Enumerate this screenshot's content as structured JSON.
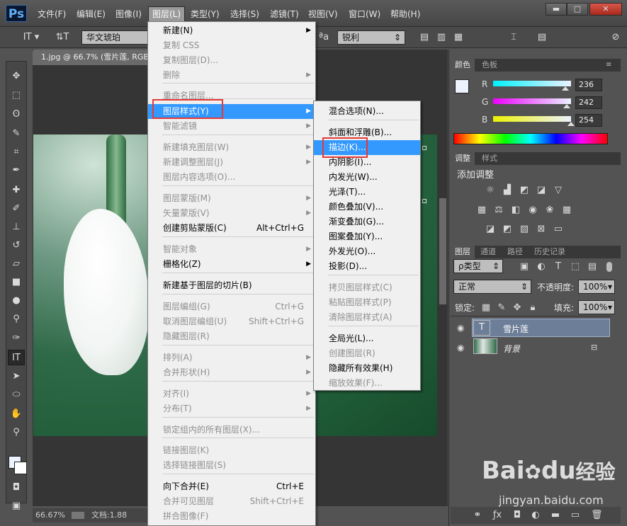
{
  "app": {
    "logo": "Ps"
  },
  "menubar": {
    "items": [
      "文件(F)",
      "编辑(E)",
      "图像(I)",
      "图层(L)",
      "类型(Y)",
      "选择(S)",
      "滤镜(T)",
      "视图(V)",
      "窗口(W)",
      "帮助(H)"
    ]
  },
  "window_buttons": {
    "minimize": "▬",
    "maximize": "□",
    "close": "✕"
  },
  "options": {
    "font_family": "华文琥珀",
    "antialias": "锐利",
    "aa_label": "ªa"
  },
  "document": {
    "tab_title": "1.jpg @ 66.7% (雪片莲, RGB",
    "zoom": "66.67%",
    "doc_info": "文档:1.88"
  },
  "layer_menu": {
    "items": [
      {
        "label": "新建(N)",
        "shortcut": "",
        "arrow": true,
        "disabled": false
      },
      {
        "label": "复制 CSS",
        "shortcut": "",
        "arrow": false,
        "disabled": true
      },
      {
        "label": "复制图层(D)...",
        "shortcut": "",
        "arrow": false,
        "disabled": true
      },
      {
        "label": "删除",
        "shortcut": "",
        "arrow": true,
        "disabled": true
      },
      {
        "label": "重命名图层...",
        "shortcut": "",
        "arrow": false,
        "disabled": true
      },
      {
        "label": "图层样式(Y)",
        "shortcut": "",
        "arrow": true,
        "disabled": false,
        "highlighted": true
      },
      {
        "label": "智能滤镜",
        "shortcut": "",
        "arrow": true,
        "disabled": true
      },
      {
        "label": "新建填充图层(W)",
        "shortcut": "",
        "arrow": true,
        "disabled": true
      },
      {
        "label": "新建调整图层(J)",
        "shortcut": "",
        "arrow": true,
        "disabled": true
      },
      {
        "label": "图层内容选项(O)...",
        "shortcut": "",
        "arrow": false,
        "disabled": true
      },
      {
        "label": "图层蒙版(M)",
        "shortcut": "",
        "arrow": true,
        "disabled": true
      },
      {
        "label": "矢量蒙版(V)",
        "shortcut": "",
        "arrow": true,
        "disabled": true
      },
      {
        "label": "创建剪贴蒙版(C)",
        "shortcut": "Alt+Ctrl+G",
        "arrow": false,
        "disabled": false
      },
      {
        "label": "智能对象",
        "shortcut": "",
        "arrow": true,
        "disabled": true
      },
      {
        "label": "栅格化(Z)",
        "shortcut": "",
        "arrow": true,
        "disabled": false
      },
      {
        "label": "新建基于图层的切片(B)",
        "shortcut": "",
        "arrow": false,
        "disabled": false
      },
      {
        "label": "图层编组(G)",
        "shortcut": "Ctrl+G",
        "arrow": false,
        "disabled": true
      },
      {
        "label": "取消图层编组(U)",
        "shortcut": "Shift+Ctrl+G",
        "arrow": false,
        "disabled": true
      },
      {
        "label": "隐藏图层(R)",
        "shortcut": "",
        "arrow": false,
        "disabled": true
      },
      {
        "label": "排列(A)",
        "shortcut": "",
        "arrow": true,
        "disabled": true
      },
      {
        "label": "合并形状(H)",
        "shortcut": "",
        "arrow": true,
        "disabled": true
      },
      {
        "label": "对齐(I)",
        "shortcut": "",
        "arrow": true,
        "disabled": true
      },
      {
        "label": "分布(T)",
        "shortcut": "",
        "arrow": true,
        "disabled": true
      },
      {
        "label": "锁定组内的所有图层(X)...",
        "shortcut": "",
        "arrow": false,
        "disabled": true
      },
      {
        "label": "链接图层(K)",
        "shortcut": "",
        "arrow": false,
        "disabled": true
      },
      {
        "label": "选择链接图层(S)",
        "shortcut": "",
        "arrow": false,
        "disabled": true
      },
      {
        "label": "向下合并(E)",
        "shortcut": "Ctrl+E",
        "arrow": false,
        "disabled": false
      },
      {
        "label": "合并可见图层",
        "shortcut": "Shift+Ctrl+E",
        "arrow": false,
        "disabled": true
      },
      {
        "label": "拼合图像(F)",
        "shortcut": "",
        "arrow": false,
        "disabled": true
      }
    ]
  },
  "style_submenu": {
    "items": [
      {
        "label": "混合选项(N)...",
        "disabled": false
      },
      {
        "label": "斜面和浮雕(B)...",
        "disabled": false
      },
      {
        "label": "描边(K)...",
        "disabled": false,
        "highlighted": true
      },
      {
        "label": "内阴影(I)...",
        "disabled": false
      },
      {
        "label": "内发光(W)...",
        "disabled": false
      },
      {
        "label": "光泽(T)...",
        "disabled": false
      },
      {
        "label": "颜色叠加(V)...",
        "disabled": false
      },
      {
        "label": "渐变叠加(G)...",
        "disabled": false
      },
      {
        "label": "图案叠加(Y)...",
        "disabled": false
      },
      {
        "label": "外发光(O)...",
        "disabled": false
      },
      {
        "label": "投影(D)...",
        "disabled": false
      },
      {
        "label": "拷贝图层样式(C)",
        "disabled": true
      },
      {
        "label": "粘贴图层样式(P)",
        "disabled": true
      },
      {
        "label": "清除图层样式(A)",
        "disabled": true
      },
      {
        "label": "全局光(L)...",
        "disabled": false
      },
      {
        "label": "创建图层(R)",
        "disabled": true
      },
      {
        "label": "隐藏所有效果(H)",
        "disabled": false
      },
      {
        "label": "缩放效果(F)...",
        "disabled": true
      }
    ]
  },
  "color_panel": {
    "tabs": [
      "颜色",
      "色板"
    ],
    "r_label": "R",
    "g_label": "G",
    "b_label": "B",
    "r": "236",
    "g": "242",
    "b": "254",
    "r_level": 0.925,
    "g_level": 0.949,
    "b_level": 0.996,
    "fg_color": "#ecf2fe"
  },
  "adjust_panel": {
    "tabs": [
      "调整",
      "样式"
    ],
    "title": "添加调整"
  },
  "layers_panel": {
    "tabs": [
      "图层",
      "通道",
      "路径",
      "历史记录"
    ],
    "filter_kind": "ρ类型",
    "blend_mode": "正常",
    "opacity_label": "不透明度:",
    "opacity": "100%",
    "lock_label": "锁定:",
    "fill_label": "填充:",
    "fill": "100%",
    "layers": [
      {
        "name": "雪片莲",
        "type": "text",
        "selected": true
      },
      {
        "name": "背景",
        "type": "image",
        "locked": true
      }
    ]
  },
  "watermark": {
    "brand": "Bai",
    "brand2": "du",
    "suffix": "经验",
    "url": "jingyan.baidu.com"
  },
  "colors": {
    "accent": "#3399ff",
    "highlight_box": "#e53935",
    "panel_bg": "#535353"
  }
}
